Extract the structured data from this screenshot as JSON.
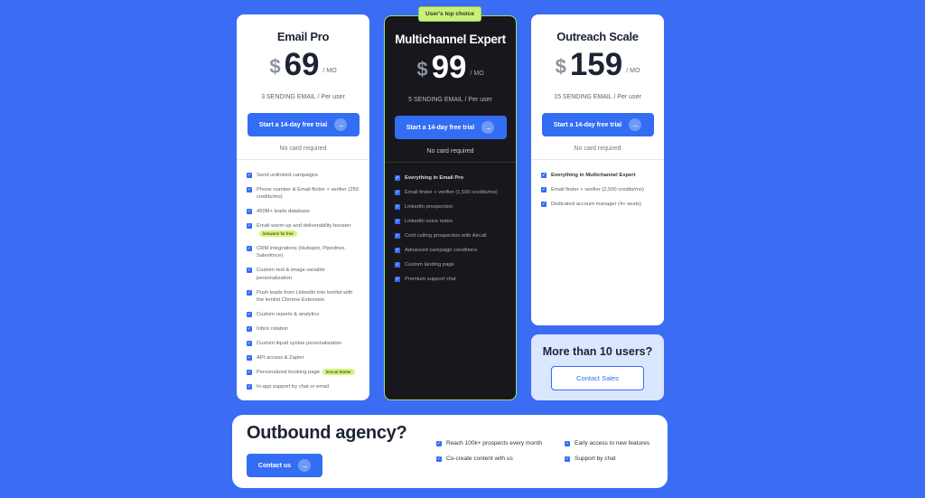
{
  "plans": [
    {
      "name": "Email Pro",
      "currency": "$",
      "price": "69",
      "period": "/ MO",
      "sending": "3 SENDING EMAIL / Per user",
      "cta": "Start a 14-day free trial",
      "note": "No card required",
      "features": [
        {
          "text": "Send unlimited campaigns"
        },
        {
          "text": "Phone number & Email finder + verifier (250 credits/mo)"
        },
        {
          "text": "450M+ leads database"
        },
        {
          "text": "Email warm-up and deliverability booster",
          "badge": "lemwarm for free"
        },
        {
          "text": "CRM integrations (Hubspot, Pipedrive, Salesforce)"
        },
        {
          "text": "Custom text & image variable personalization"
        },
        {
          "text": "Push leads from LinkedIn into lemlist with the lemlist Chrome Extension"
        },
        {
          "text": "Custom reports & analytics"
        },
        {
          "text": "Inbox rotation"
        },
        {
          "text": "Custom liquid syntax personalization"
        },
        {
          "text": "API access & Zapier"
        },
        {
          "text": "Personalized booking page",
          "badge": "lemcal Starter"
        },
        {
          "text": "In-app support by chat or email"
        }
      ]
    },
    {
      "name": "Multichannel Expert",
      "currency": "$",
      "price": "99",
      "period": "/ MO",
      "sending": "5 SENDING EMAIL / Per user",
      "cta": "Start a 14-day free trial",
      "note": "No card required",
      "badge": "User's top choice",
      "features": [
        {
          "text": "Everything in Email Pro",
          "bold": true
        },
        {
          "text": "Email finder + verifier (1,500 credits/mo)"
        },
        {
          "text": "LinkedIn prospection"
        },
        {
          "text": "LinkedIn voice notes"
        },
        {
          "text": "Cold calling prospection with Aircall"
        },
        {
          "text": "Advanced campaign conditions"
        },
        {
          "text": "Custom landing page"
        },
        {
          "text": "Premium support chat"
        }
      ]
    },
    {
      "name": "Outreach Scale",
      "currency": "$",
      "price": "159",
      "period": "/ MO",
      "sending": "15 SENDING EMAIL / Per user",
      "cta": "Start a 14-day free trial",
      "note": "No card required",
      "features": [
        {
          "text": "Everything in Multichannel Expert",
          "bold": true
        },
        {
          "text": "Email finder + verifier (2,500 credits/mo)"
        },
        {
          "text": "Dedicated account manager (4+ seats)"
        }
      ]
    }
  ],
  "contact": {
    "title": "More than 10 users?",
    "button": "Contact Sales"
  },
  "agency": {
    "title": "Outbound agency?",
    "button": "Contact us",
    "features": [
      "Reach 100k+ prospects every month",
      "Early access to new features",
      "Co-create content with us",
      "Support by chat"
    ]
  },
  "colors": {
    "background": "#3a6cf4",
    "accent": "#336df4",
    "badge": "#d7f57a"
  }
}
